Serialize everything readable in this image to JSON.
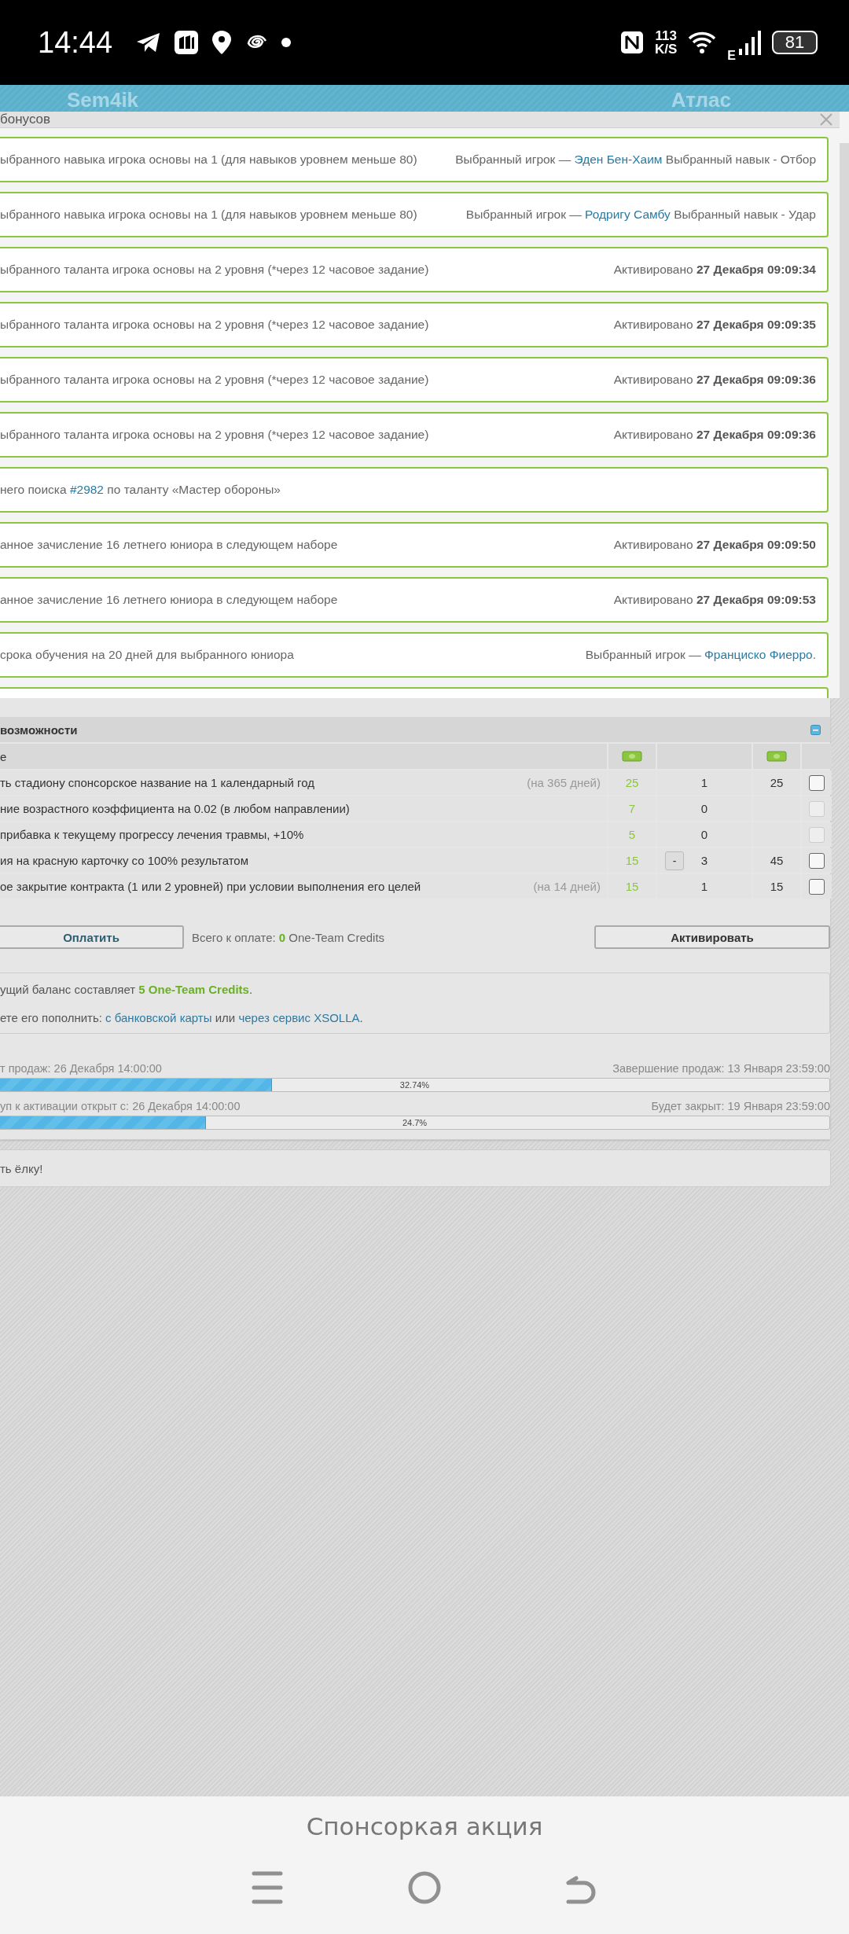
{
  "status_bar": {
    "time": "14:44",
    "speed": "113",
    "speed_unit": "K/S",
    "network": "E",
    "battery": "81"
  },
  "site_header": {
    "logo": "Sem4ik",
    "right_title": "Атлас"
  },
  "modal": {
    "title": "бонусов",
    "rows": [
      {
        "description": [
          {
            "kind": "plain",
            "text": "ыбранного навыка игрока основы на 1 (для навыков уровнем меньше 80)"
          }
        ],
        "status": [
          {
            "kind": "plain",
            "text": "Выбранный игрок — "
          },
          {
            "kind": "link",
            "text": "Эден Бен-Хаим"
          },
          {
            "kind": "plain",
            "text": " Выбранный навык - Отбор"
          }
        ]
      },
      {
        "description": [
          {
            "kind": "plain",
            "text": "ыбранного навыка игрока основы на 1 (для навыков уровнем меньше 80)"
          }
        ],
        "status": [
          {
            "kind": "plain",
            "text": "Выбранный игрок — "
          },
          {
            "kind": "link",
            "text": "Родригу Самбу"
          },
          {
            "kind": "plain",
            "text": " Выбранный навык - Удар"
          }
        ]
      },
      {
        "description": [
          {
            "kind": "plain",
            "text": "ыбранного таланта игрока основы на 2 уровня (*через 12 часовое задание)"
          }
        ],
        "status": [
          {
            "kind": "plain",
            "text": "Активировано "
          },
          {
            "kind": "bold",
            "text": "27 Декабря 09:09:34"
          }
        ]
      },
      {
        "description": [
          {
            "kind": "plain",
            "text": "ыбранного таланта игрока основы на 2 уровня (*через 12 часовое задание)"
          }
        ],
        "status": [
          {
            "kind": "plain",
            "text": "Активировано "
          },
          {
            "kind": "bold",
            "text": "27 Декабря 09:09:35"
          }
        ]
      },
      {
        "description": [
          {
            "kind": "plain",
            "text": "ыбранного таланта игрока основы на 2 уровня (*через 12 часовое задание)"
          }
        ],
        "status": [
          {
            "kind": "plain",
            "text": "Активировано "
          },
          {
            "kind": "bold",
            "text": "27 Декабря 09:09:36"
          }
        ]
      },
      {
        "description": [
          {
            "kind": "plain",
            "text": "ыбранного таланта игрока основы на 2 уровня (*через 12 часовое задание)"
          }
        ],
        "status": [
          {
            "kind": "plain",
            "text": "Активировано "
          },
          {
            "kind": "bold",
            "text": "27 Декабря 09:09:36"
          }
        ]
      },
      {
        "description": [
          {
            "kind": "plain",
            "text": "него поиска "
          },
          {
            "kind": "link",
            "text": "#2982"
          },
          {
            "kind": "plain",
            "text": " по таланту «Мастер обороны»"
          }
        ]
      },
      {
        "description": [
          {
            "kind": "plain",
            "text": "анное зачисление 16 летнего юниора в следующем наборе"
          }
        ],
        "status": [
          {
            "kind": "plain",
            "text": "Активировано "
          },
          {
            "kind": "bold",
            "text": "27 Декабря 09:09:50"
          }
        ]
      },
      {
        "description": [
          {
            "kind": "plain",
            "text": "анное зачисление 16 летнего юниора в следующем наборе"
          }
        ],
        "status": [
          {
            "kind": "plain",
            "text": "Активировано "
          },
          {
            "kind": "bold",
            "text": "27 Декабря 09:09:53"
          }
        ]
      },
      {
        "description": [
          {
            "kind": "plain",
            "text": " срока обучения на 20 дней для выбранного юниора"
          }
        ],
        "status": [
          {
            "kind": "plain",
            "text": "Выбранный игрок — "
          },
          {
            "kind": "link",
            "text": "Франциско Фиерро"
          },
          {
            "kind": "plain",
            "text": "."
          }
        ]
      }
    ]
  },
  "options": {
    "title": "возможности",
    "header": "е",
    "rows": [
      {
        "name": "ть стадиону спонсорское название на 1 календарный год",
        "note": "(на 365 дней)",
        "price": "25",
        "qty": "1",
        "total": "25",
        "checked": false,
        "disabled": false
      },
      {
        "name": "ние возрастного коэффициента на 0.02 (в любом направлении)",
        "price": "7",
        "qty": "0",
        "checked": false,
        "disabled": true
      },
      {
        "name": " прибавка к текущему прогрессу лечения травмы, +10%",
        "price": "5",
        "qty": "0",
        "checked": false,
        "disabled": true
      },
      {
        "name": "ия на красную карточку со 100% результатом",
        "price": "15",
        "decrement": "-",
        "qty": "3",
        "total": "45",
        "checked": false,
        "disabled": false
      },
      {
        "name": "ое закрытие контракта (1 или 2 уровней) при условии выполнения его целей",
        "note": "(на 14 дней)",
        "price": "15",
        "qty": "1",
        "total": "15",
        "checked": false,
        "disabled": false
      }
    ]
  },
  "payment": {
    "pay_button": "Оплатить",
    "total_label": "Всего к оплате: ",
    "total_value": "0",
    "total_unit": " One-Team Credits",
    "activate_button": "Активировать"
  },
  "balance": {
    "lines": [
      [
        {
          "kind": "plain",
          "text": "ущий баланс составляет "
        },
        {
          "kind": "credit",
          "text": "5 One-Team Credits"
        },
        {
          "kind": "plain",
          "text": "."
        }
      ],
      [
        {
          "kind": "plain",
          "text": "ете его пополнить: "
        },
        {
          "kind": "link",
          "text": "с банковской карты"
        },
        {
          "kind": "plain",
          "text": " или "
        },
        {
          "kind": "link",
          "text": "через сервис XSOLLA"
        },
        {
          "kind": "plain",
          "text": "."
        }
      ]
    ]
  },
  "progress": [
    {
      "start": "т продаж: 26 Декабря 14:00:00",
      "end": "Завершение продаж: 13 Января 23:59:00",
      "level": 0.3274,
      "label": "32.74%"
    },
    {
      "start": "уп к активации открыт с: 26 Декабря 14:00:00",
      "end": "Будет закрыт: 19 Января 23:59:00",
      "level": 0.247,
      "label": "24.7%"
    }
  ],
  "notice": "ть ёлку!",
  "bottom_bar": {
    "title": "Спонсоркая акция"
  }
}
